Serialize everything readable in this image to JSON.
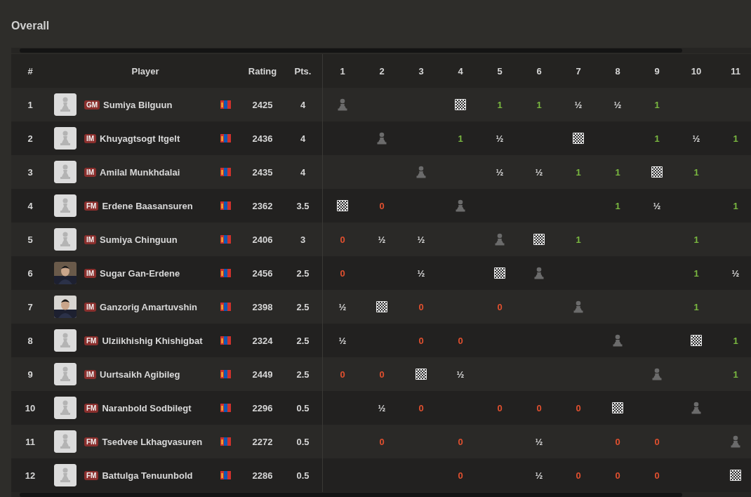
{
  "heading": "Overall",
  "columns": {
    "rank": "#",
    "player": "Player",
    "rating": "Rating",
    "points": "Pts.",
    "rounds": [
      "1",
      "2",
      "3",
      "4",
      "5",
      "6",
      "7",
      "8",
      "9",
      "10",
      "11"
    ]
  },
  "rows": [
    {
      "rank": "1",
      "avatar": {
        "kind": "pawn"
      },
      "title": "GM",
      "name": "Sumiya Bilguun",
      "rating": "2425",
      "points": "4",
      "cells": [
        {
          "kind": "self"
        },
        {
          "kind": "empty"
        },
        {
          "kind": "empty"
        },
        {
          "kind": "checker"
        },
        {
          "kind": "win",
          "text": "1"
        },
        {
          "kind": "win",
          "text": "1"
        },
        {
          "kind": "draw",
          "text": "½"
        },
        {
          "kind": "draw",
          "text": "½"
        },
        {
          "kind": "win",
          "text": "1"
        },
        {
          "kind": "empty"
        },
        {
          "kind": "empty"
        }
      ]
    },
    {
      "rank": "2",
      "avatar": {
        "kind": "pawn"
      },
      "title": "IM",
      "name": "Khuyagtsogt Itgelt",
      "rating": "2436",
      "points": "4",
      "cells": [
        {
          "kind": "empty"
        },
        {
          "kind": "self"
        },
        {
          "kind": "empty"
        },
        {
          "kind": "win",
          "text": "1"
        },
        {
          "kind": "draw",
          "text": "½"
        },
        {
          "kind": "empty"
        },
        {
          "kind": "checker"
        },
        {
          "kind": "empty"
        },
        {
          "kind": "win",
          "text": "1"
        },
        {
          "kind": "draw",
          "text": "½"
        },
        {
          "kind": "win",
          "text": "1"
        }
      ]
    },
    {
      "rank": "3",
      "avatar": {
        "kind": "pawn"
      },
      "title": "IM",
      "name": "Amilal Munkhdalai",
      "rating": "2435",
      "points": "4",
      "cells": [
        {
          "kind": "empty"
        },
        {
          "kind": "empty"
        },
        {
          "kind": "self"
        },
        {
          "kind": "empty"
        },
        {
          "kind": "draw",
          "text": "½"
        },
        {
          "kind": "draw",
          "text": "½"
        },
        {
          "kind": "win",
          "text": "1"
        },
        {
          "kind": "win",
          "text": "1"
        },
        {
          "kind": "checker"
        },
        {
          "kind": "win",
          "text": "1"
        },
        {
          "kind": "empty"
        }
      ]
    },
    {
      "rank": "4",
      "avatar": {
        "kind": "pawn"
      },
      "title": "FM",
      "name": "Erdene Baasansuren",
      "rating": "2362",
      "points": "3.5",
      "cells": [
        {
          "kind": "checker"
        },
        {
          "kind": "loss",
          "text": "0"
        },
        {
          "kind": "empty"
        },
        {
          "kind": "self"
        },
        {
          "kind": "empty"
        },
        {
          "kind": "empty"
        },
        {
          "kind": "empty"
        },
        {
          "kind": "win",
          "text": "1"
        },
        {
          "kind": "draw",
          "text": "½"
        },
        {
          "kind": "empty"
        },
        {
          "kind": "win",
          "text": "1"
        }
      ]
    },
    {
      "rank": "5",
      "avatar": {
        "kind": "pawn"
      },
      "title": "IM",
      "name": "Sumiya Chinguun",
      "rating": "2406",
      "points": "3",
      "cells": [
        {
          "kind": "loss",
          "text": "0"
        },
        {
          "kind": "draw",
          "text": "½"
        },
        {
          "kind": "draw",
          "text": "½"
        },
        {
          "kind": "empty"
        },
        {
          "kind": "self"
        },
        {
          "kind": "checker"
        },
        {
          "kind": "win",
          "text": "1"
        },
        {
          "kind": "empty"
        },
        {
          "kind": "empty"
        },
        {
          "kind": "win",
          "text": "1"
        },
        {
          "kind": "empty"
        }
      ]
    },
    {
      "rank": "6",
      "avatar": {
        "kind": "picture"
      },
      "title": "IM",
      "name": "Sugar Gan-Erdene",
      "rating": "2456",
      "points": "2.5",
      "cells": [
        {
          "kind": "loss",
          "text": "0"
        },
        {
          "kind": "empty"
        },
        {
          "kind": "draw",
          "text": "½"
        },
        {
          "kind": "empty"
        },
        {
          "kind": "checker"
        },
        {
          "kind": "self"
        },
        {
          "kind": "empty"
        },
        {
          "kind": "empty"
        },
        {
          "kind": "empty"
        },
        {
          "kind": "win",
          "text": "1"
        },
        {
          "kind": "draw",
          "text": "½"
        }
      ]
    },
    {
      "rank": "7",
      "avatar": {
        "kind": "picture"
      },
      "title": "IM",
      "name": "Ganzorig Amartuvshin",
      "rating": "2398",
      "points": "2.5",
      "cells": [
        {
          "kind": "draw",
          "text": "½"
        },
        {
          "kind": "checker"
        },
        {
          "kind": "loss",
          "text": "0"
        },
        {
          "kind": "empty"
        },
        {
          "kind": "loss",
          "text": "0"
        },
        {
          "kind": "empty"
        },
        {
          "kind": "self"
        },
        {
          "kind": "empty"
        },
        {
          "kind": "empty"
        },
        {
          "kind": "win",
          "text": "1"
        },
        {
          "kind": "empty"
        }
      ]
    },
    {
      "rank": "8",
      "avatar": {
        "kind": "pawn"
      },
      "title": "FM",
      "name": "Ulziikhishig Khishigbat",
      "rating": "2324",
      "points": "2.5",
      "cells": [
        {
          "kind": "draw",
          "text": "½"
        },
        {
          "kind": "empty"
        },
        {
          "kind": "loss",
          "text": "0"
        },
        {
          "kind": "loss",
          "text": "0"
        },
        {
          "kind": "empty"
        },
        {
          "kind": "empty"
        },
        {
          "kind": "empty"
        },
        {
          "kind": "self"
        },
        {
          "kind": "empty"
        },
        {
          "kind": "checker"
        },
        {
          "kind": "win",
          "text": "1"
        }
      ]
    },
    {
      "rank": "9",
      "avatar": {
        "kind": "pawn"
      },
      "title": "IM",
      "name": "Uurtsaikh Agibileg",
      "rating": "2449",
      "points": "2.5",
      "cells": [
        {
          "kind": "loss",
          "text": "0"
        },
        {
          "kind": "loss",
          "text": "0"
        },
        {
          "kind": "checker"
        },
        {
          "kind": "draw",
          "text": "½"
        },
        {
          "kind": "empty"
        },
        {
          "kind": "empty"
        },
        {
          "kind": "empty"
        },
        {
          "kind": "empty"
        },
        {
          "kind": "self"
        },
        {
          "kind": "empty"
        },
        {
          "kind": "win",
          "text": "1"
        }
      ]
    },
    {
      "rank": "10",
      "avatar": {
        "kind": "pawn"
      },
      "title": "FM",
      "name": "Naranbold Sodbilegt",
      "rating": "2296",
      "points": "0.5",
      "cells": [
        {
          "kind": "empty"
        },
        {
          "kind": "draw",
          "text": "½"
        },
        {
          "kind": "loss",
          "text": "0"
        },
        {
          "kind": "empty"
        },
        {
          "kind": "loss",
          "text": "0"
        },
        {
          "kind": "loss",
          "text": "0"
        },
        {
          "kind": "loss",
          "text": "0"
        },
        {
          "kind": "checker"
        },
        {
          "kind": "empty"
        },
        {
          "kind": "self"
        },
        {
          "kind": "empty"
        }
      ]
    },
    {
      "rank": "11",
      "avatar": {
        "kind": "pawn"
      },
      "title": "FM",
      "name": "Tsedvee Lkhagvasuren",
      "rating": "2272",
      "points": "0.5",
      "cells": [
        {
          "kind": "empty"
        },
        {
          "kind": "loss",
          "text": "0"
        },
        {
          "kind": "empty"
        },
        {
          "kind": "loss",
          "text": "0"
        },
        {
          "kind": "empty"
        },
        {
          "kind": "draw",
          "text": "½"
        },
        {
          "kind": "empty"
        },
        {
          "kind": "loss",
          "text": "0"
        },
        {
          "kind": "loss",
          "text": "0"
        },
        {
          "kind": "empty"
        },
        {
          "kind": "self"
        }
      ]
    },
    {
      "rank": "12",
      "avatar": {
        "kind": "pawn"
      },
      "title": "FM",
      "name": "Battulga Tenuunbold",
      "rating": "2286",
      "points": "0.5",
      "cells": [
        {
          "kind": "empty"
        },
        {
          "kind": "empty"
        },
        {
          "kind": "empty"
        },
        {
          "kind": "loss",
          "text": "0"
        },
        {
          "kind": "empty"
        },
        {
          "kind": "draw",
          "text": "½"
        },
        {
          "kind": "loss",
          "text": "0"
        },
        {
          "kind": "loss",
          "text": "0"
        },
        {
          "kind": "loss",
          "text": "0"
        },
        {
          "kind": "empty"
        },
        {
          "kind": "checker"
        }
      ]
    }
  ]
}
